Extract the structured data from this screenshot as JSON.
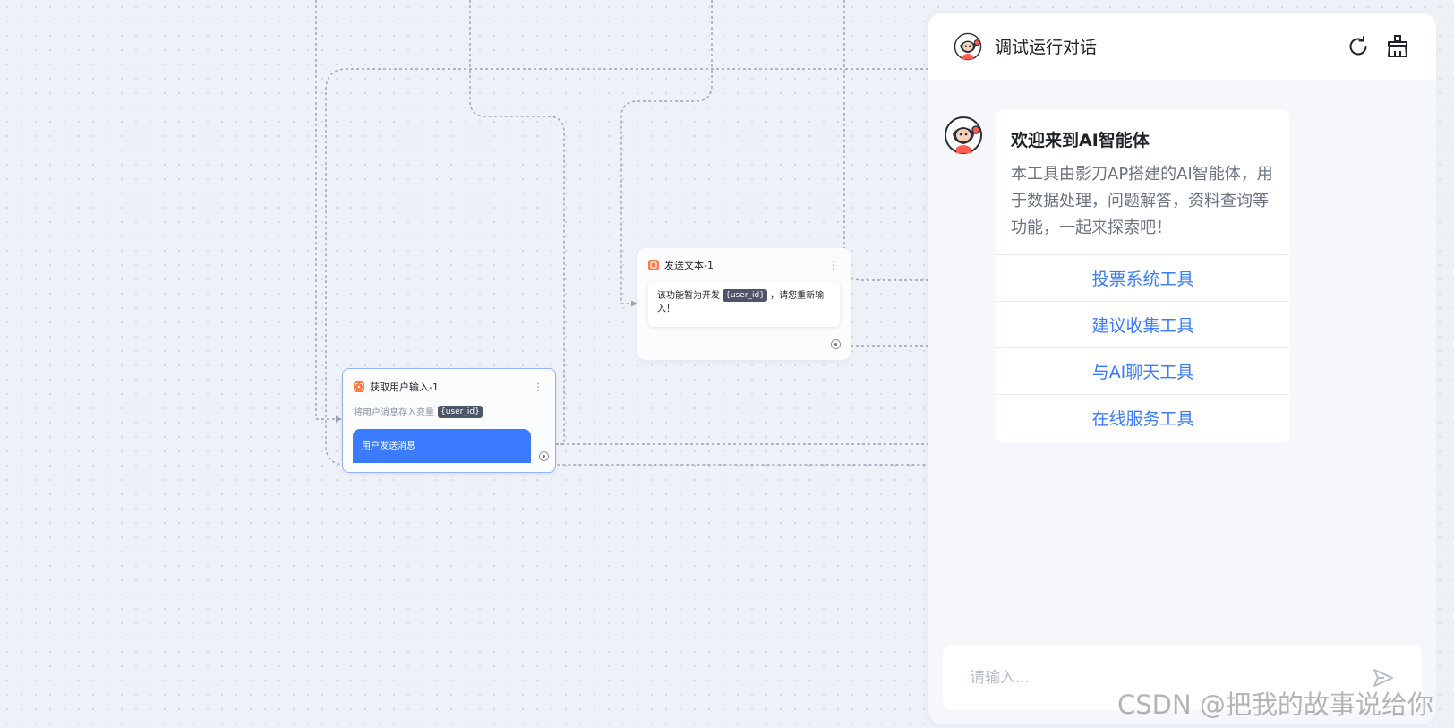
{
  "colors": {
    "accent": "#3a7bff",
    "node_icon": "#ff7a45",
    "canvas_bg": "#eef1f8",
    "edge": "#9aa1b2",
    "var_tag_bg": "#4e5569"
  },
  "nodes": {
    "send_text": {
      "title": "发送文本-1",
      "icon": "stop-icon",
      "message_before": "该功能暂为开发",
      "message_var": "{user_id}",
      "message_after": "，请您重新输入！"
    },
    "get_input": {
      "title": "获取用户输入-1",
      "icon": "scan-icon",
      "description": "将用户消息存入变量",
      "var": "{user_id}",
      "trigger_label": "用户发送消息"
    }
  },
  "chat": {
    "title": "调试运行对话",
    "header_icons": [
      "refresh-icon",
      "broom-icon"
    ],
    "welcome_title": "欢迎来到AI智能体",
    "welcome_text": "本工具由影刀AP搭建的AI智能体，用于数据处理，问题解答，资料查询等功能，一起来探索吧！",
    "tools": [
      "投票系统工具",
      "建议收集工具",
      "与AI聊天工具",
      "在线服务工具"
    ],
    "input_placeholder": "请输入...",
    "send_icon": "send-icon"
  },
  "watermark": "CSDN @把我的故事说给你"
}
